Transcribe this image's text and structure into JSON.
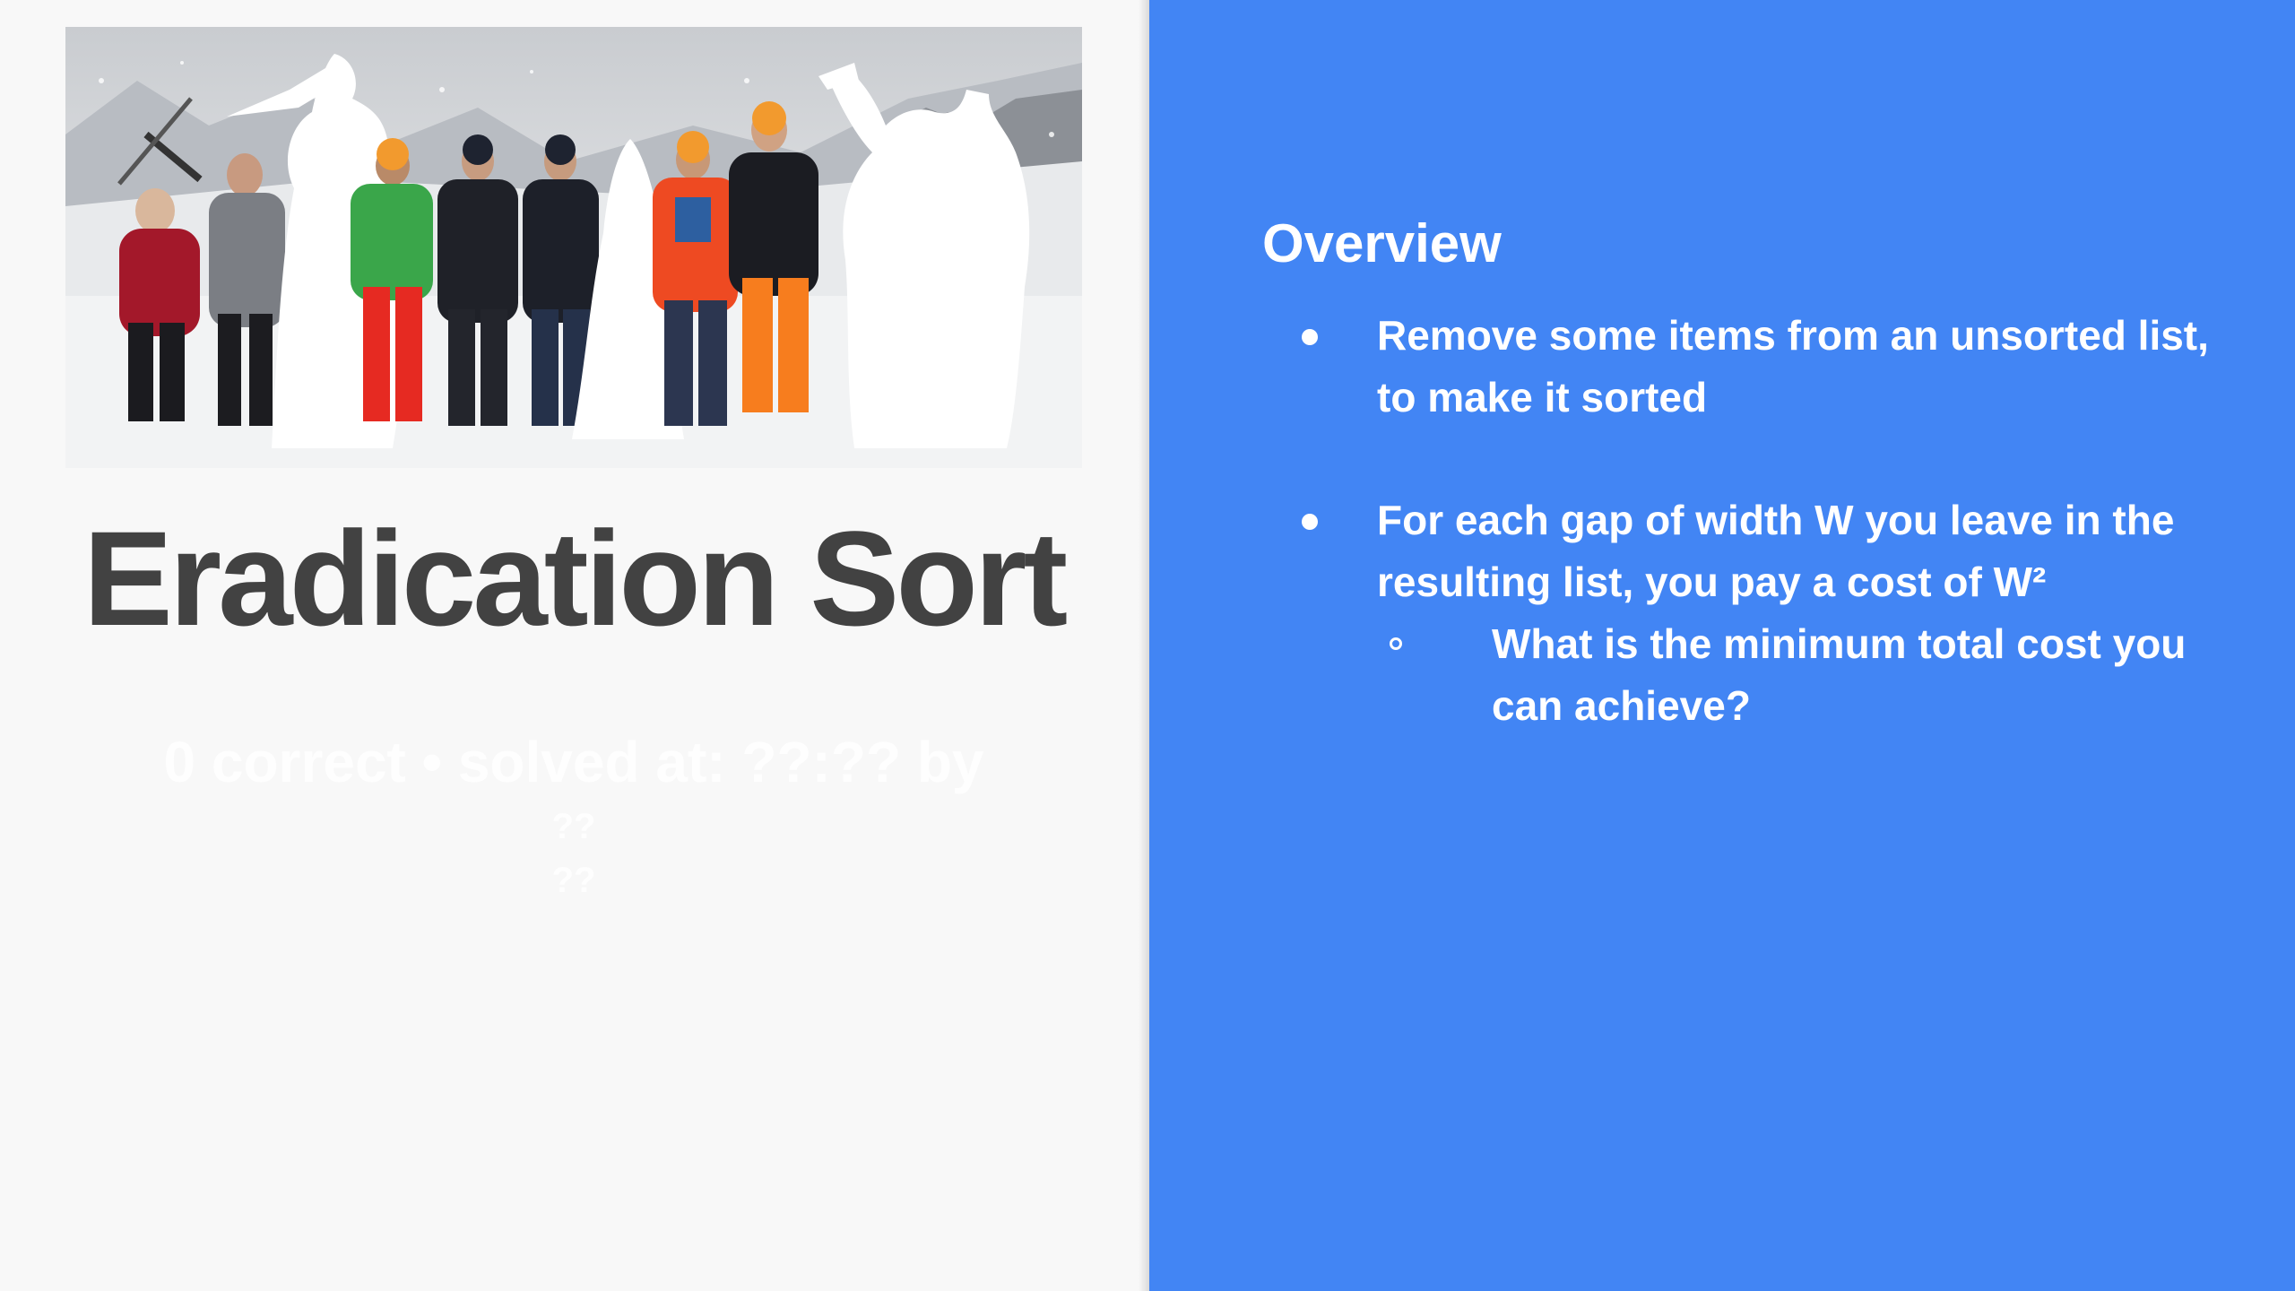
{
  "left": {
    "photo": {
      "icon": "group-photo-icon"
    },
    "title": "Eradication Sort",
    "status": {
      "line1": "0 correct • solved at: ??:?? by",
      "line2": "??",
      "line3": "??"
    }
  },
  "right": {
    "heading": "Overview",
    "bullets": [
      {
        "text": "Remove some items from an unsorted list, to make it sorted"
      },
      {
        "text": "For each gap of width W you leave in the resulting list, you pay a cost of W²",
        "sub": [
          "What is the minimum total cost you can achieve?"
        ]
      }
    ]
  },
  "colors": {
    "accent": "#4285f4",
    "title": "#424242",
    "background": "#f8f8f8"
  }
}
